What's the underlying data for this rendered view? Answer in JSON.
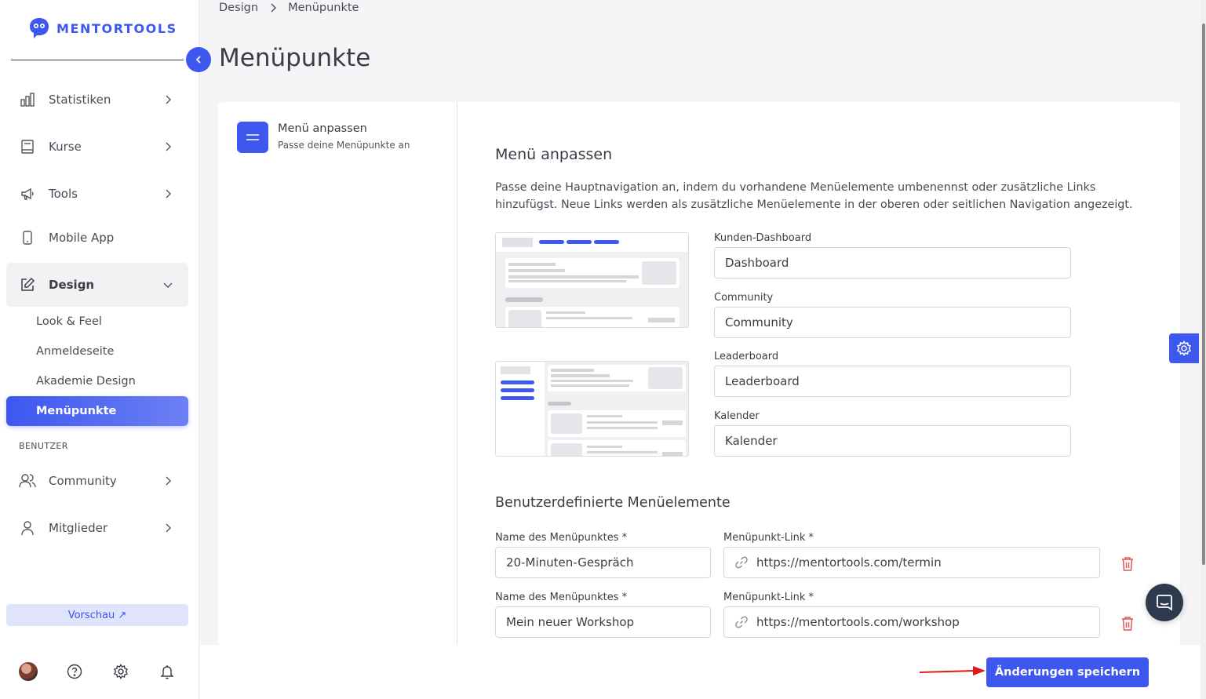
{
  "brand": {
    "name": "MENTORTOOLS",
    "color": "#3d57ef"
  },
  "sidebar": {
    "items": [
      {
        "label": "Statistiken",
        "icon": "bar-chart-icon"
      },
      {
        "label": "Kurse",
        "icon": "book-icon"
      },
      {
        "label": "Tools",
        "icon": "megaphone-icon"
      },
      {
        "label": "Mobile App",
        "icon": "smartphone-icon"
      },
      {
        "label": "Design",
        "icon": "edit-icon"
      }
    ],
    "design_sub": [
      "Look & Feel",
      "Anmeldeseite",
      "Akademie Design",
      "Menüpunkte"
    ],
    "section_label": "BENUTZER",
    "user_items": [
      {
        "label": "Community",
        "icon": "users-icon"
      },
      {
        "label": "Mitglieder",
        "icon": "user-icon"
      }
    ],
    "preview_label": "Vorschau ↗"
  },
  "breadcrumb": {
    "parent": "Design",
    "current": "Menüpunkte"
  },
  "page_title": "Menüpunkte",
  "step": {
    "title": "Menü anpassen",
    "subtitle": "Passe deine Menüpunkte an"
  },
  "main": {
    "section1_title": "Menü anpassen",
    "description": "Passe deine Hauptnavigation an, indem du vorhandene Menüelemente umbenennst oder zusätzliche Links hinzufügst. Neue Links werden als zusätzliche Menüelemente in der oberen oder seitlichen Navigation angezeigt.",
    "fields": [
      {
        "label": "Kunden-Dashboard",
        "value": "Dashboard"
      },
      {
        "label": "Community",
        "value": "Community"
      },
      {
        "label": "Leaderboard",
        "value": "Leaderboard"
      },
      {
        "label": "Kalender",
        "value": "Kalender"
      }
    ],
    "section2_title": "Benutzerdefinierte Menüelemente",
    "custom_items": [
      {
        "name_label": "Name des Menüpunktes *",
        "name": "20-Minuten-Gespräch",
        "link_label": "Menüpunkt-Link *",
        "link": "https://mentortools.com/termin"
      },
      {
        "name_label": "Name des Menüpunktes *",
        "name": "Mein neuer Workshop",
        "link_label": "Menüpunkt-Link *",
        "link": "https://mentortools.com/workshop"
      }
    ]
  },
  "footer": {
    "save_label": "Änderungen speichern"
  }
}
